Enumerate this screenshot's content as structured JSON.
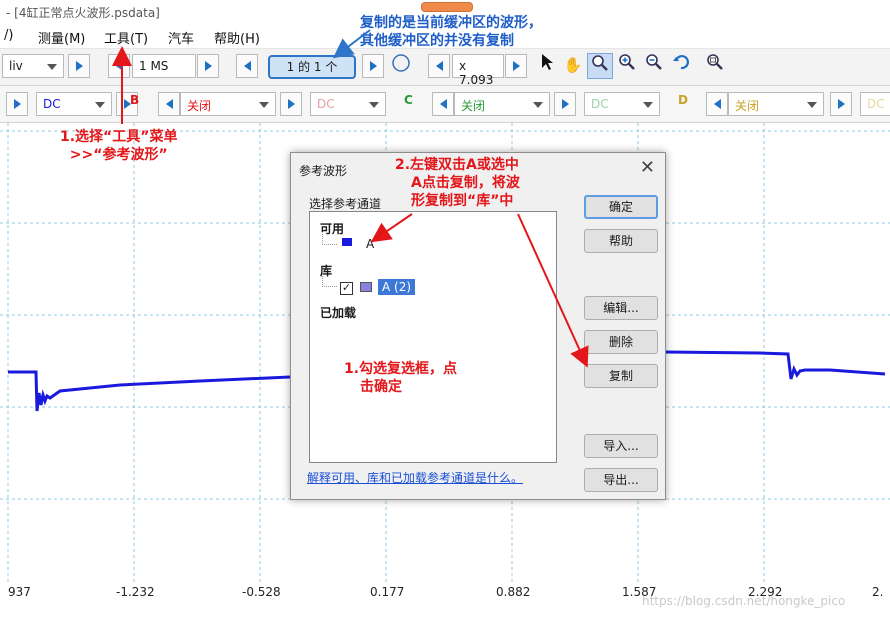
{
  "window": {
    "title": "- [4缸正常点火波形.psdata]"
  },
  "menu": {
    "items": [
      "/)",
      "测量(M)",
      "工具(T)",
      "汽车",
      "帮助(H)"
    ]
  },
  "toolbar1": {
    "div_combo": "liv",
    "timebase": "1 MS",
    "buffer_indicator": "1 的 1 个",
    "zoom": "x 7.093"
  },
  "toolbar2": {
    "a_coupling": "DC",
    "b_label": "B",
    "b_range": "关闭",
    "b_coupling": "DC",
    "c_label": "C",
    "c_range": "关闭",
    "c_coupling": "DC",
    "d_label": "D",
    "d_range": "关闭",
    "d_coupling": "DC"
  },
  "colors": {
    "a": "#1a1adf",
    "b": "#e3161a",
    "c": "#2a9a3a",
    "d": "#c9a227",
    "annot_red": "#e3161a",
    "annot_blue": "#1f5ec9"
  },
  "axis": {
    "ticks": [
      "937",
      "-1.232",
      "-0.528",
      "0.177",
      "0.882",
      "1.587",
      "2.292",
      "2."
    ]
  },
  "annotations": {
    "a1": "复制的是当前缓冲区的波形，",
    "a2": "其他缓冲区的并没有复制",
    "b1": "1.选择“工具”菜单",
    "b2": ">>“参考波形”",
    "c1": "2.左键双击A或选中",
    "c2": "A点击复制，将波",
    "c3": "形复制到“库”中",
    "d1": "1.勾选复选框，点",
    "d2": "击确定"
  },
  "dialog": {
    "title": "参考波形",
    "subtitle": "选择参考通道",
    "available": "可用",
    "available_item": "A",
    "library": "库",
    "library_item": "A (2)",
    "loaded": "已加载",
    "buttons": {
      "ok": "确定",
      "help": "帮助",
      "edit": "编辑...",
      "delete": "删除",
      "copy": "复制",
      "import": "导入...",
      "export": "导出..."
    },
    "link": "解释可用、库和已加载参考通道是什么。"
  },
  "watermark": "https://blog.csdn.net/hongke_pico"
}
